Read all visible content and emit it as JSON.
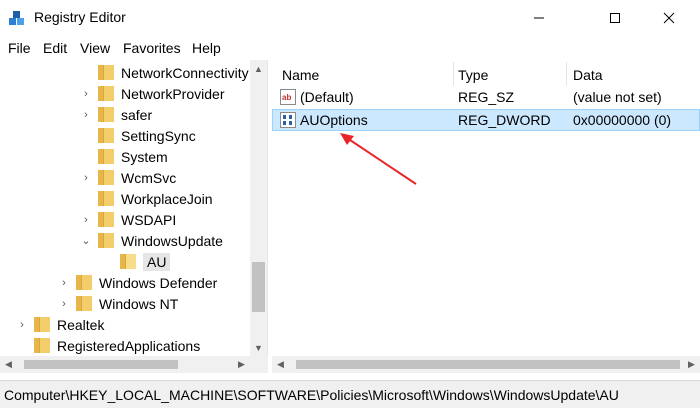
{
  "window": {
    "title": "Registry Editor",
    "icon": "registry-cubes-icon",
    "controls": [
      "minimize-icon",
      "maximize-icon",
      "close-icon"
    ]
  },
  "menu": [
    "File",
    "Edit",
    "View",
    "Favorites",
    "Help"
  ],
  "tree": {
    "items": [
      {
        "label": "NetworkConnectivity",
        "expander": "none",
        "level": 2
      },
      {
        "label": "NetworkProvider",
        "expander": "collapsed",
        "level": 2
      },
      {
        "label": "safer",
        "expander": "collapsed",
        "level": 2
      },
      {
        "label": "SettingSync",
        "expander": "none",
        "level": 2
      },
      {
        "label": "System",
        "expander": "none",
        "level": 2
      },
      {
        "label": "WcmSvc",
        "expander": "collapsed",
        "level": 2
      },
      {
        "label": "WorkplaceJoin",
        "expander": "none",
        "level": 2
      },
      {
        "label": "WSDAPI",
        "expander": "collapsed",
        "level": 2
      },
      {
        "label": "WindowsUpdate",
        "expander": "expanded",
        "level": 2
      },
      {
        "label": "AU",
        "expander": "none",
        "level": 3,
        "selected": true
      },
      {
        "label": "Windows Defender",
        "expander": "collapsed",
        "level": 1
      },
      {
        "label": "Windows NT",
        "expander": "collapsed",
        "level": 1
      },
      {
        "label": "Realtek",
        "expander": "collapsed",
        "level": 0
      },
      {
        "label": "RegisteredApplications",
        "expander": "none",
        "level": 0
      }
    ]
  },
  "list": {
    "columns": [
      "Name",
      "Type",
      "Data"
    ],
    "rows": [
      {
        "name": "(Default)",
        "type": "REG_SZ",
        "data": "(value not set)",
        "icon": "string-value-icon",
        "selected": false
      },
      {
        "name": "AUOptions",
        "type": "REG_DWORD",
        "data": "0x00000000 (0)",
        "icon": "binary-value-icon",
        "selected": true
      }
    ]
  },
  "status": {
    "path": "Computer\\HKEY_LOCAL_MACHINE\\SOFTWARE\\Policies\\Microsoft\\Windows\\WindowsUpdate\\AU"
  },
  "colors": {
    "selection_bg": "#cce8ff",
    "selection_border": "#99d1ff",
    "folder": "#f3cd6a",
    "annotation_arrow": "#e8262a"
  }
}
